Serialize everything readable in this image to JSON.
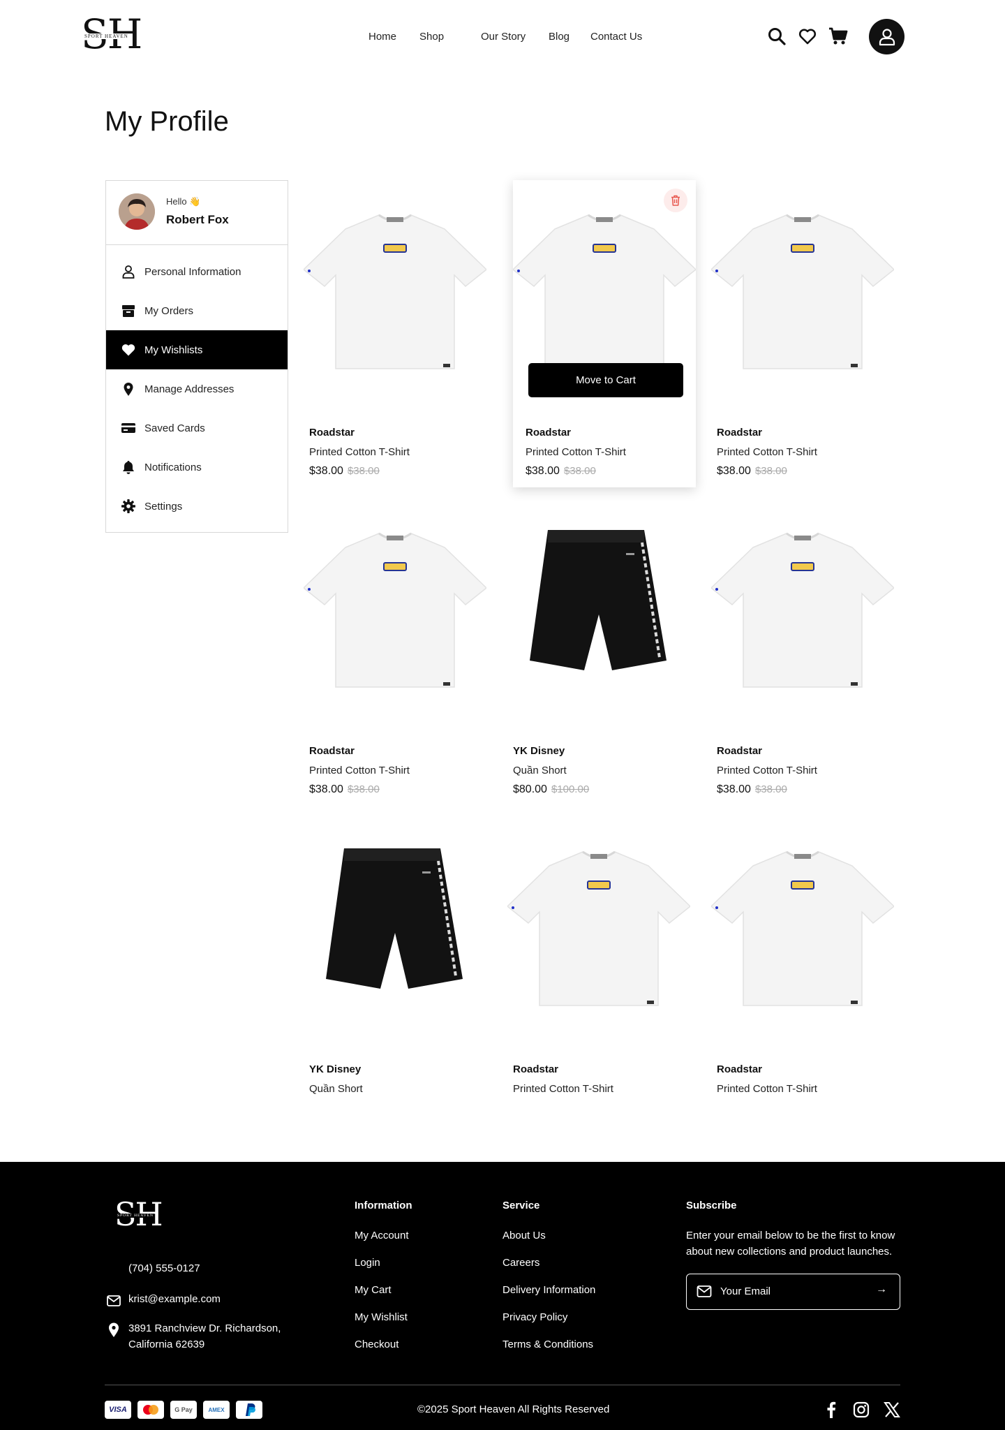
{
  "brand": {
    "logo_big": "SH",
    "logo_small": "SPORT HEAVEN"
  },
  "nav": {
    "home": "Home",
    "shop": "Shop",
    "our_story": "Our Story",
    "blog": "Blog",
    "contact": "Contact Us"
  },
  "page_title": "My Profile",
  "user": {
    "greeting": "Hello 👋",
    "name": "Robert Fox"
  },
  "menu": [
    {
      "label": "Personal Information",
      "icon": "user-icon"
    },
    {
      "label": "My Orders",
      "icon": "box-icon"
    },
    {
      "label": "My Wishlists",
      "icon": "heart-icon",
      "active": true
    },
    {
      "label": "Manage Addresses",
      "icon": "location-pin-icon"
    },
    {
      "label": "Saved Cards",
      "icon": "card-icon"
    },
    {
      "label": "Notifications",
      "icon": "bell-icon"
    },
    {
      "label": "Settings",
      "icon": "gear-icon"
    }
  ],
  "wishlist": {
    "move_to_cart": "Move to Cart",
    "items": [
      {
        "brand": "Roadstar",
        "name": "Printed Cotton T-Shirt",
        "price": "$38.00",
        "old_price": "$38.00",
        "type": "tshirt"
      },
      {
        "brand": "Roadstar",
        "name": "Printed Cotton T-Shirt",
        "price": "$38.00",
        "old_price": "$38.00",
        "type": "tshirt"
      },
      {
        "brand": "Roadstar",
        "name": "Printed Cotton T-Shirt",
        "price": "$38.00",
        "old_price": "$38.00",
        "type": "tshirt"
      },
      {
        "brand": "Roadstar",
        "name": "Printed Cotton T-Shirt",
        "price": "$38.00",
        "old_price": "$38.00",
        "type": "tshirt"
      },
      {
        "brand": "YK Disney",
        "name": "Quần Short",
        "price": "$80.00",
        "old_price": "$100.00",
        "type": "shorts"
      },
      {
        "brand": "Roadstar",
        "name": "Printed Cotton T-Shirt",
        "price": "$38.00",
        "old_price": "$38.00",
        "type": "tshirt"
      },
      {
        "brand": "YK Disney",
        "name": "Quần Short",
        "type": "shorts"
      },
      {
        "brand": "Roadstar",
        "name": "Printed Cotton T-Shirt",
        "type": "tshirt"
      },
      {
        "brand": "Roadstar",
        "name": "Printed Cotton T-Shirt",
        "type": "tshirt"
      }
    ]
  },
  "footer": {
    "phone": "(704) 555-0127",
    "email": "krist@example.com",
    "address_line1": "3891 Ranchview Dr. Richardson,",
    "address_line2": "California 62639",
    "info_heading": "Information",
    "info_links": [
      "My Account",
      "Login",
      "My Cart",
      "My Wishlist",
      "Checkout"
    ],
    "service_heading": "Service",
    "service_links": [
      "About Us",
      "Careers",
      "Delivery Information",
      "Privacy Policy",
      "Terms & Conditions"
    ],
    "subscribe_heading": "Subscribe",
    "subscribe_text_1": "Enter your email below to be the first to know",
    "subscribe_text_2": "about new collections and product launches.",
    "email_placeholder": "Your Email",
    "copyright": "©2025 Sport Heaven  All Rights Reserved",
    "payments": [
      "VISA",
      "mastercard",
      "G Pay",
      "AMEX",
      "PayPal"
    ]
  },
  "colors": {
    "accent": "#000000",
    "delete": "#e8584f"
  }
}
